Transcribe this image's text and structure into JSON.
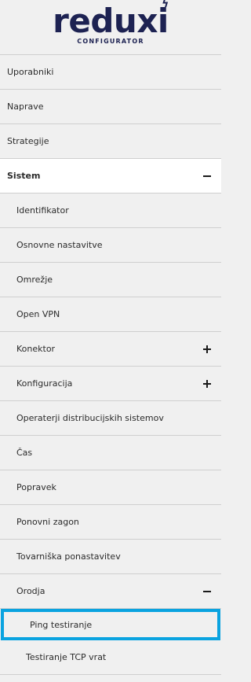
{
  "logo": {
    "word": "reduxi",
    "sub": "CONFIGURATOR"
  },
  "menu": {
    "users": "Uporabniki",
    "devices": "Naprave",
    "strategies": "Strategije",
    "system": "Sistem",
    "system_items": {
      "identifier": "Identifikator",
      "basic": "Osnovne nastavitve",
      "network": "Omrežje",
      "vpn": "Open VPN",
      "connector": "Konektor",
      "configuration": "Konfiguracija",
      "dso": "Operaterji distribucijskih sistemov",
      "time": "Čas",
      "fix": "Popravek",
      "restart": "Ponovni zagon",
      "factory": "Tovarniška ponastavitev",
      "tools": "Orodja"
    },
    "tools_items": {
      "ping": "Ping testiranje",
      "tcp": "Testiranje TCP vrat"
    }
  },
  "colors": {
    "brand": "#1d2252",
    "selected_border": "#0aa3e0",
    "background": "#f0f0f0"
  }
}
